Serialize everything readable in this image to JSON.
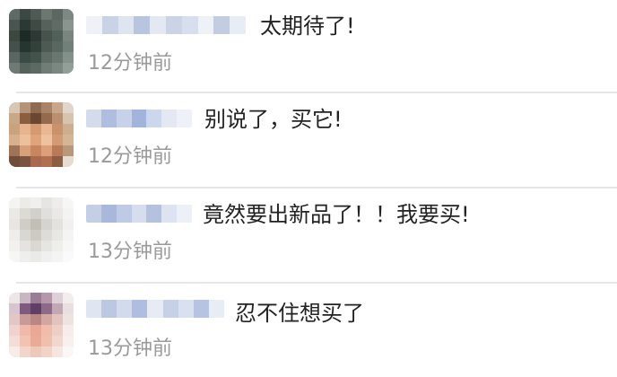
{
  "comments": [
    {
      "text": "太期待了!",
      "time": "12分钟前"
    },
    {
      "text": "别说了，买它!",
      "time": "12分钟前"
    },
    {
      "text": "竟然要出新品了！！我要买!",
      "time": "13分钟前"
    },
    {
      "text": "忍不住想买了",
      "time": "13分钟前"
    }
  ]
}
